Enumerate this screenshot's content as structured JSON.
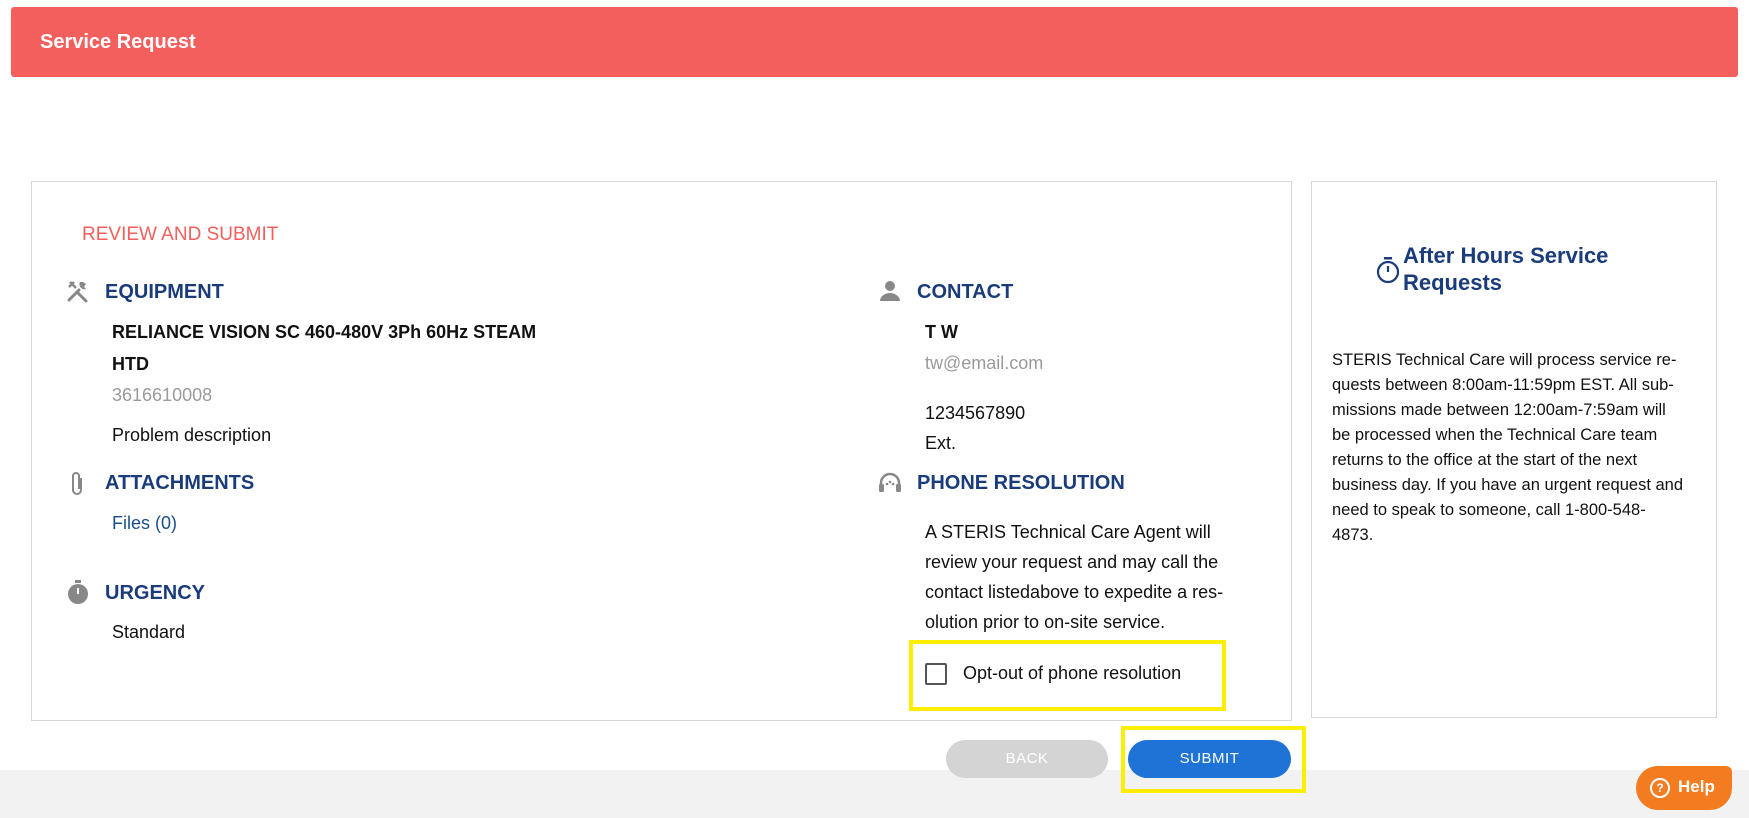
{
  "header": {
    "title": "Service Request"
  },
  "review": {
    "heading": "REVIEW AND SUBMIT",
    "equipment": {
      "label": "EQUIPMENT",
      "name_line1": "RELIANCE VISION SC 460-480V 3Ph 60Hz STEAM",
      "name_line2": "HTD",
      "serial": "3616610008",
      "problem": "Problem description"
    },
    "attachments": {
      "label": "ATTACHMENTS",
      "files_link": "Files (0)"
    },
    "urgency": {
      "label": "URGENCY",
      "value": "Standard"
    },
    "contact": {
      "label": "CONTACT",
      "name": "T W",
      "email": "tw@email.com",
      "phone": "1234567890",
      "ext": "Ext."
    },
    "phone_resolution": {
      "label": "PHONE RESOLUTION",
      "line1": "A STERIS Technical Care Agent will",
      "line2": "review your request and may call the",
      "line3": "contact listedabove to expedite a res-",
      "line4": "olution prior to on-site service.",
      "optout_label": "Opt-out of phone resolution",
      "optout_checked": false
    }
  },
  "after_hours": {
    "title_line1": "After Hours Service",
    "title_line2": "Requests",
    "body_lines": [
      "STERIS Technical Care will process service re-",
      "quests between 8:00am-11:59pm EST. All sub-",
      "missions made between 12:00am-7:59am will",
      "be processed when the Technical Care team",
      "returns to the office at the start of the next",
      "business day. If you have an urgent request and",
      "need to speak to someone, call 1-800-548-",
      "4873."
    ]
  },
  "buttons": {
    "back": "BACK",
    "submit": "SUBMIT"
  },
  "help": {
    "label": "Help"
  },
  "colors": {
    "header": "#f25f5c",
    "accent_blue": "#1a3c7a",
    "submit_blue": "#1f72d6",
    "help_orange": "#f37c20",
    "highlight": "#ffee00"
  },
  "icons": {
    "equipment": "tools-icon",
    "attachments": "paperclip-icon",
    "urgency": "stopwatch-icon",
    "contact": "person-icon",
    "phone_resolution": "headset-icon",
    "after_hours": "timer-icon"
  }
}
